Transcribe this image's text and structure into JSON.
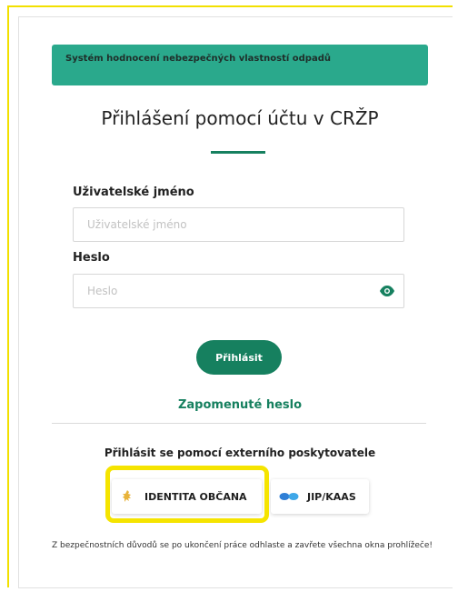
{
  "banner": {
    "text": "Systém hodnocení nebezpečných vlastností odpadů"
  },
  "page_title": "Přihlášení pomocí účtu v CRŽP",
  "username": {
    "label": "Uživatelské jméno",
    "placeholder": "Uživatelské jméno",
    "value": ""
  },
  "password": {
    "label": "Heslo",
    "placeholder": "Heslo",
    "value": "",
    "toggle_icon": "eye-icon"
  },
  "login_button": "Přihlásit",
  "forgot_link": "Zapomenuté heslo",
  "external": {
    "title": "Přihlásit se pomocí externího poskytovatele",
    "providers": [
      {
        "label": "IDENTITA OBČANA",
        "icon": "lion-icon"
      },
      {
        "label": "JIP/KAAS",
        "icon": "jip-logo-icon"
      }
    ]
  },
  "security_note": "Z bezpečnostních důvodů se po ukončení práce odhlaste a zavřete všechna okna prohlížeče!",
  "colors": {
    "brand": "#16805f",
    "banner": "#2aa98c",
    "highlight": "#f5e400"
  }
}
